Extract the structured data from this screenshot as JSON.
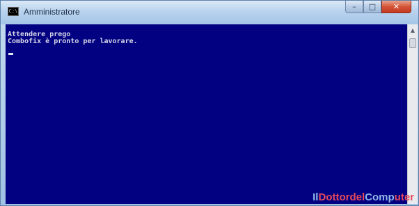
{
  "window": {
    "title": "Amministratore",
    "icon": "command-prompt-icon",
    "icon_glyph": "C:\\"
  },
  "controls": {
    "minimize_glyph": "–",
    "maximize_glyph": "□",
    "close_glyph": "✕"
  },
  "console": {
    "background": "#010182",
    "lines": [
      "Attendere prego",
      "Combofix è pronto per lavorare."
    ]
  },
  "watermark": {
    "part1": "Il",
    "part2": "Dott",
    "part3": "ordel",
    "part4": "Comp",
    "part5": "uter"
  }
}
